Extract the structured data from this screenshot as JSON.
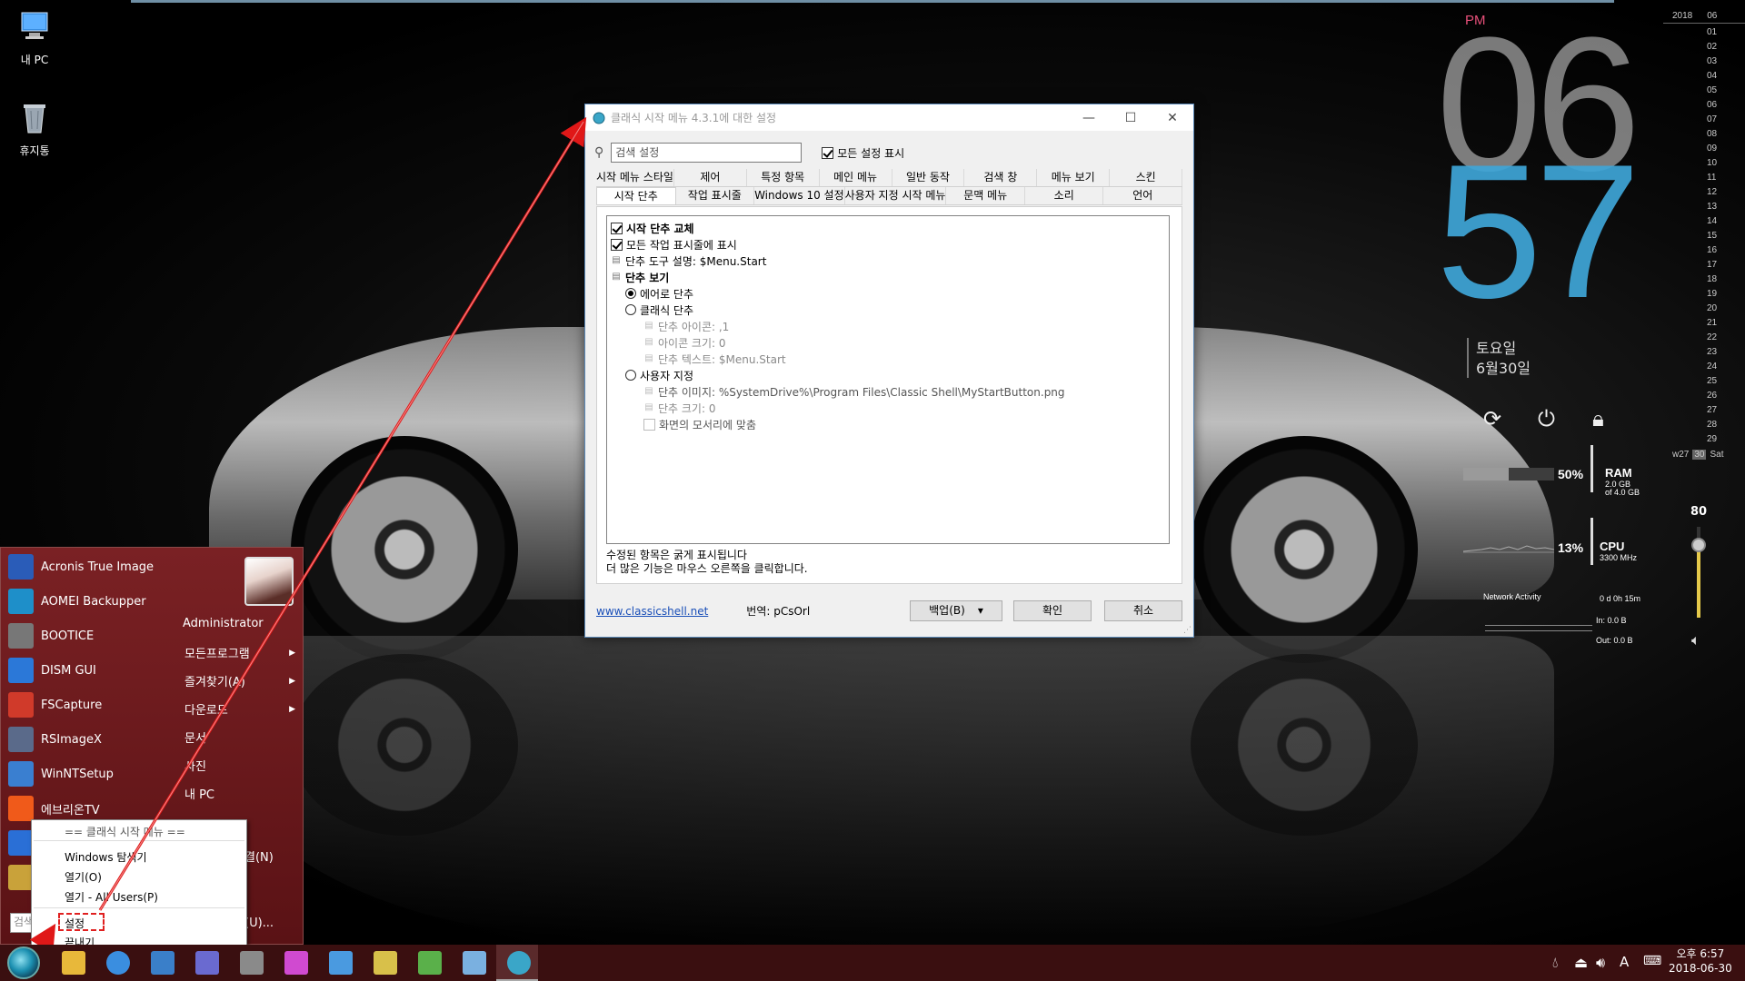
{
  "desktop": {
    "icons": [
      {
        "label": "내 PC",
        "icon": "computer-icon"
      },
      {
        "label": "휴지통",
        "icon": "recycle-bin-icon"
      }
    ]
  },
  "clock": {
    "ampm": "PM",
    "hour": "06",
    "minute": "57",
    "weekday": "토요일",
    "date": "6월30일"
  },
  "monitor": {
    "ram_percent_label": "50%",
    "ram_percent": 50,
    "ram_title": "RAM",
    "ram_used": "2.0 GB",
    "ram_total": "of 4.0 GB",
    "cpu_percent_label": "13%",
    "cpu_percent": 13,
    "cpu_title": "CPU",
    "cpu_freq": "3300 MHz",
    "network_title": "Network Activity",
    "uptime": "0 d 0h 15m",
    "net_in": "In: 0.0 B",
    "net_out": "Out: 0.0 B"
  },
  "calendar": {
    "year": "2018",
    "month": "06",
    "days": [
      "01",
      "02",
      "03",
      "04",
      "05",
      "06",
      "07",
      "08",
      "09",
      "10",
      "11",
      "12",
      "13",
      "14",
      "15",
      "16",
      "17",
      "18",
      "19",
      "20",
      "21",
      "22",
      "23",
      "24",
      "25",
      "26",
      "27",
      "28",
      "29"
    ],
    "week": "w27",
    "today": "30",
    "today_day": "Sat"
  },
  "volume": {
    "value_label": "80",
    "level": 0.8
  },
  "dialog": {
    "title": "클래식 시작 메뉴 4.3.1에 대한 설정",
    "search_placeholder": "검색 설정",
    "show_all_label": "모든 설정 표시",
    "show_all_checked": true,
    "tabs_row1": [
      "시작 메뉴 스타일",
      "제어",
      "특정 항목",
      "메인 메뉴",
      "일반 동작",
      "검색 창",
      "메뉴 보기",
      "스킨"
    ],
    "tabs_row2": [
      "시작 단추",
      "작업 표시줄",
      "Windows 10 설정",
      "사용자 지정 시작 메뉴",
      "문맥 메뉴",
      "소리",
      "언어"
    ],
    "active_tab": "시작 단추",
    "tree": {
      "replace_start": "시작 단추 교체",
      "show_all_taskbars": "모든 작업 표시줄에 표시",
      "tooltip": "단추 도구 설명: $Menu.Start",
      "button_look": "단추 보기",
      "aero": "에어로 단추",
      "classic": "클래식 단추",
      "classic_icon": "단추 아이콘: ,1",
      "classic_icon_size": "아이콘 크기: 0",
      "classic_text": "단추 텍스트: $Menu.Start",
      "custom": "사용자 지정",
      "custom_image": "단추 이미지: %SystemDrive%\\Program Files\\Classic Shell\\MyStartButton.png",
      "custom_size": "단추 크기: 0",
      "fit_corner": "화면의 모서리에 맞춤"
    },
    "note_line1": "수정된 항목은 굵게 표시됩니다",
    "note_line2": "더 많은 기능은 마우스 오른쪽을 클릭합니다.",
    "link": "www.classicshell.net",
    "translation": "번역: pCsOrl",
    "backup_label": "백업(B)",
    "ok_label": "확인",
    "cancel_label": "취소"
  },
  "start_menu": {
    "apps": [
      {
        "label": "Acronis True Image",
        "color": "#2a5cb8"
      },
      {
        "label": "AOMEI Backupper",
        "color": "#1e8fc9"
      },
      {
        "label": "BOOTICE",
        "color": "#777777"
      },
      {
        "label": "DISM GUI",
        "color": "#2b78d8"
      },
      {
        "label": "FSCapture",
        "color": "#d03a2a"
      },
      {
        "label": "RSImageX",
        "color": "#5a6a8a"
      },
      {
        "label": "WinNTSetup",
        "color": "#3a7fd0"
      },
      {
        "label": "에브리온TV",
        "color": "#f05a1a"
      }
    ],
    "user": "Administrator",
    "right_items": [
      {
        "label": "모든프로그램",
        "arrow": true
      },
      {
        "label": "즐겨찾기(A)",
        "arrow": true
      },
      {
        "label": "다운로드",
        "arrow": true
      },
      {
        "label": "문서",
        "arrow": false
      },
      {
        "label": "사진",
        "arrow": false
      },
      {
        "label": "내 PC",
        "arrow": false
      }
    ],
    "right_partial_1": "결(N)",
    "right_partial_2": "(U)...",
    "search_text": "검색"
  },
  "context_menu": {
    "header": "== 클래식 시작 메뉴 ==",
    "items": [
      "Windows 탐색기",
      "열기(O)",
      "열기 - All Users(P)",
      "설정",
      "끝내기"
    ],
    "highlighted": "설정"
  },
  "taskbar": {
    "time": "오후 6:57",
    "date": "2018-06-30",
    "ime": "A",
    "pinned": [
      "file-explorer-icon",
      "internet-explorer-icon",
      "floppy-save-icon",
      "network-icon",
      "bee-icon",
      "color-palette-icon",
      "grid-icon",
      "archive-icon",
      "plant-icon",
      "droplet-icon",
      "classic-shell-icon"
    ]
  }
}
